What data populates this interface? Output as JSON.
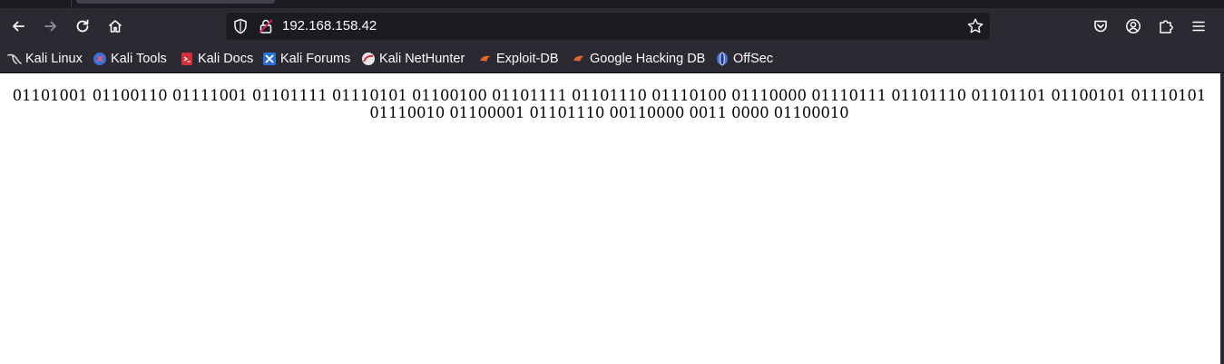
{
  "browser": {
    "url": "192.168.158.42",
    "colors": {
      "toolbar": "#2b2a33",
      "urlbar": "#1c1b22",
      "text": "#fbfbfe",
      "page": "#ffffff"
    }
  },
  "bookmarks": [
    {
      "label": "Kali Linux",
      "icon": "kali-dragon-icon"
    },
    {
      "label": "Kali Tools",
      "icon": "kali-tools-icon"
    },
    {
      "label": "Kali Docs",
      "icon": "kali-docs-icon"
    },
    {
      "label": "Kali Forums",
      "icon": "kali-forums-icon"
    },
    {
      "label": "Kali NetHunter",
      "icon": "kali-nethunter-icon"
    },
    {
      "label": "Exploit-DB",
      "icon": "exploit-db-icon"
    },
    {
      "label": "Google Hacking DB",
      "icon": "ghdb-icon"
    },
    {
      "label": "OffSec",
      "icon": "offsec-icon"
    }
  ],
  "page": {
    "body_text": "01101001 01100110 01111001 01101111 01110101 01100100 01101111 01101110 01110100 01110000 01110111 01101110 01101101 01100101 01110101 01110010 01100001 01101110 00110000 0011 0000 01100010"
  }
}
